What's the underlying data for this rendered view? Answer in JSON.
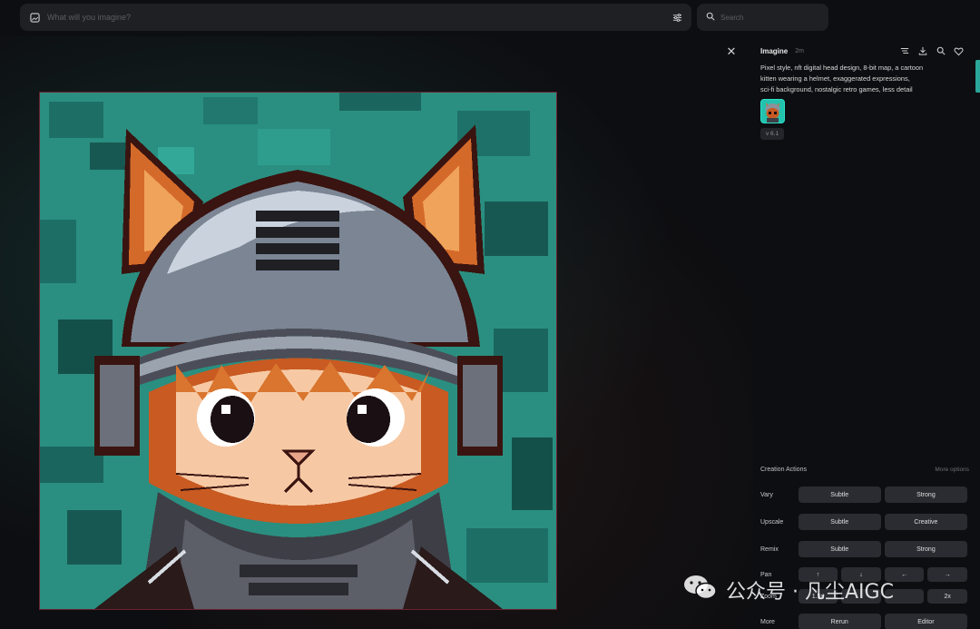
{
  "topbar": {
    "prompt_placeholder": "What will you imagine?",
    "search_placeholder": "Search"
  },
  "icons": {
    "image": "image-icon",
    "settings": "sliders-icon",
    "search": "search-icon",
    "close": "close-icon",
    "filter": "filter-icon",
    "download": "download-icon",
    "zoom": "magnify-icon",
    "like": "heart-icon"
  },
  "panel": {
    "title": "Imagine",
    "time": "2m",
    "prompt_lines": [
      "Pixel style, nft digital head design, 8-bit map, a cartoon",
      "kitten wearing a helmet, exaggerated expressions,",
      "sci-fi background, nostalgic retro games, less detail"
    ],
    "version": "v 6.1",
    "close_glyph": "✕"
  },
  "actions": {
    "title": "Creation Actions",
    "more": "More options",
    "rows": [
      {
        "label": "Vary",
        "buttons": [
          "Subtle",
          "Strong"
        ]
      },
      {
        "label": "Upscale",
        "buttons": [
          "Subtle",
          "Creative"
        ]
      },
      {
        "label": "Remix",
        "buttons": [
          "Subtle",
          "Strong"
        ]
      },
      {
        "label": "Pan",
        "buttons": [
          "↑",
          "↓",
          "←",
          "→"
        ]
      },
      {
        "label": "Zoom",
        "buttons": [
          "1.5x",
          "",
          "",
          "2x"
        ]
      },
      {
        "label": "More",
        "buttons": [
          "Rerun",
          "Editor"
        ]
      }
    ]
  },
  "watermark": {
    "text": "公众号 · 凡尘AIGC"
  },
  "colors": {
    "background": "#0d0e11",
    "field": "#1f2024",
    "button": "#2b2c31",
    "teal": "#2a8f80",
    "accent": "#23c2ae"
  }
}
